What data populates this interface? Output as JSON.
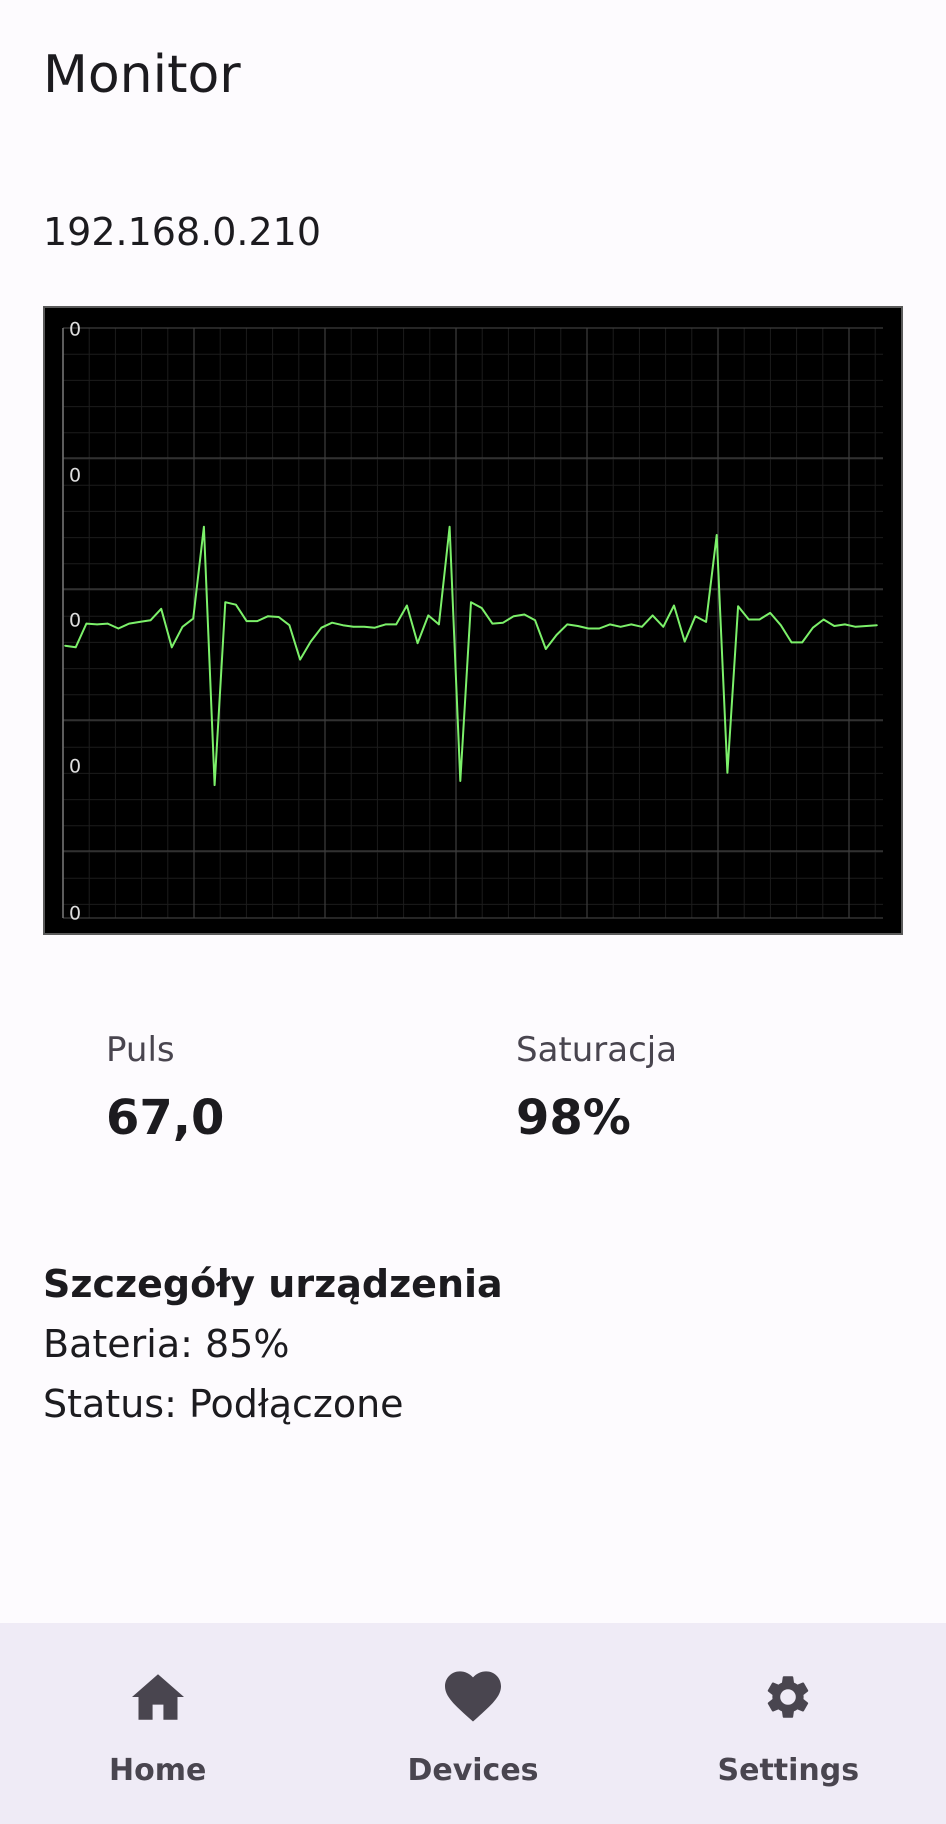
{
  "app": {
    "title": "Monitor"
  },
  "device": {
    "ip": "192.168.0.210"
  },
  "chart_data": {
    "type": "line",
    "title": "",
    "xlabel": "",
    "ylabel": "",
    "y_tick_labels": [
      "0",
      "0",
      "0",
      "0",
      "0"
    ],
    "grid": true,
    "background_color": "#000000",
    "line_color": "#7cf06a",
    "series": [
      {
        "values": [
          0.15,
          0.13,
          0.42,
          0.41,
          0.42,
          0.36,
          0.42,
          0.44,
          0.46,
          0.6,
          0.13,
          0.38,
          0.48,
          1.6,
          -1.55,
          0.68,
          0.65,
          0.45,
          0.45,
          0.51,
          0.5,
          0.4,
          -0.02,
          0.2,
          0.37,
          0.43,
          0.4,
          0.38,
          0.38,
          0.37,
          0.41,
          0.41,
          0.64,
          0.18,
          0.52,
          0.41,
          1.6,
          -1.5,
          0.68,
          0.61,
          0.42,
          0.43,
          0.51,
          0.53,
          0.46,
          0.11,
          0.28,
          0.41,
          0.39,
          0.36,
          0.36,
          0.41,
          0.38,
          0.41,
          0.38,
          0.52,
          0.38,
          0.64,
          0.2,
          0.51,
          0.44,
          1.5,
          -1.4,
          0.63,
          0.47,
          0.47,
          0.55,
          0.4,
          0.19,
          0.19,
          0.37,
          0.47,
          0.39,
          0.41,
          0.38,
          0.39,
          0.4
        ]
      }
    ]
  },
  "metrics": {
    "pulse": {
      "label": "Puls",
      "value": "67,0"
    },
    "saturation": {
      "label": "Saturacja",
      "value": "98%"
    }
  },
  "details": {
    "title": "Szczegóły urządzenia",
    "battery": "Bateria: 85%",
    "status": "Status: Podłączone"
  },
  "nav": {
    "items": [
      {
        "label": "Home",
        "icon": "home-icon"
      },
      {
        "label": "Devices",
        "icon": "heart-icon"
      },
      {
        "label": "Settings",
        "icon": "gear-icon"
      }
    ]
  }
}
